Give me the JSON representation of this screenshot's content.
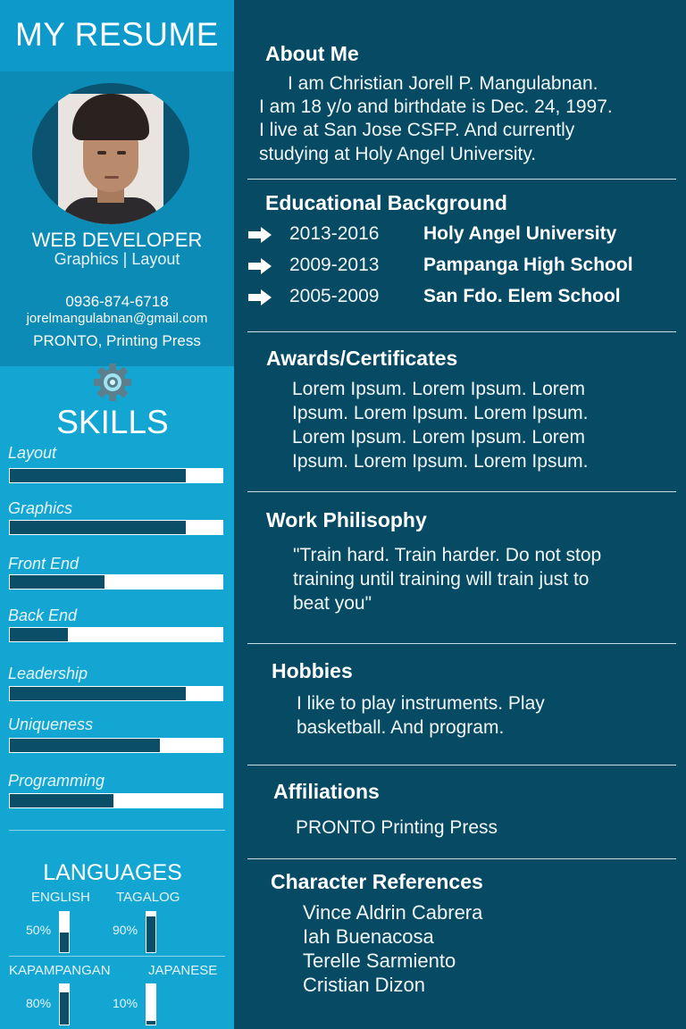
{
  "sidebar": {
    "title": "MY RESUME",
    "role": "WEB DEVELOPER",
    "role_sub": "Graphics | Layout",
    "phone": "0936-874-6718",
    "email": "jorelmangulabnan@gmail.com",
    "company": "PRONTO, Printing Press",
    "skills_title": "SKILLS",
    "skills": [
      {
        "label": "Layout",
        "level": 0.83
      },
      {
        "label": "Graphics",
        "level": 0.83
      },
      {
        "label": "Front End",
        "level": 0.45
      },
      {
        "label": "Back End",
        "level": 0.28
      },
      {
        "label": "Leadership",
        "level": 0.83
      },
      {
        "label": "Uniqueness",
        "level": 0.71
      },
      {
        "label": "Programming",
        "level": 0.49
      }
    ],
    "languages_title": "LANGUAGES",
    "languages": [
      {
        "name": "ENGLISH",
        "percent": "50%",
        "level": 0.5
      },
      {
        "name": "TAGALOG",
        "percent": "90%",
        "level": 0.9
      },
      {
        "name": "KAPAMPANGAN",
        "percent": "80%",
        "level": 0.8
      },
      {
        "name": "JAPANESE",
        "percent": "10%",
        "level": 0.1
      }
    ]
  },
  "about": {
    "title": "About Me",
    "lines": [
      "I am Christian Jorell P. Mangulabnan.",
      "I am 18 y/o and birthdate is Dec. 24, 1997.",
      "I live at San Jose CSFP. And currently",
      "studying at Holy Angel University."
    ]
  },
  "education": {
    "title": "Educational Background",
    "items": [
      {
        "years": "2013-2016",
        "school": "Holy Angel University"
      },
      {
        "years": "2009-2013",
        "school": "Pampanga High School"
      },
      {
        "years": "2005-2009",
        "school": "San Fdo. Elem School"
      }
    ]
  },
  "awards": {
    "title": "Awards/Certificates",
    "lines": [
      "Lorem Ipsum. Lorem Ipsum. Lorem",
      "Ipsum. Lorem Ipsum. Lorem Ipsum.",
      "Lorem Ipsum. Lorem Ipsum. Lorem",
      "Ipsum. Lorem Ipsum. Lorem Ipsum."
    ]
  },
  "philosophy": {
    "title": "Work Philisophy",
    "lines": [
      "\"Train hard. Train harder. Do not stop",
      "training until training will train just to",
      "beat you\""
    ]
  },
  "hobbies": {
    "title": "Hobbies",
    "lines": [
      "I like to play instruments. Play",
      "basketball. And program."
    ]
  },
  "affiliations": {
    "title": "Affiliations",
    "text": "PRONTO Printing Press"
  },
  "references": {
    "title": "Character References",
    "names": [
      "Vince Aldrin Cabrera",
      "Iah Buenacosa",
      "Terelle Sarmiento",
      "Cristian Dizon"
    ]
  },
  "colors": {
    "dark_panel": "#064a63",
    "sidebar": "#13a6d3",
    "bar_fill": "#0a4e67"
  },
  "icons": {
    "skills": "gear-icon",
    "education_bullet": "arrow-right-icon"
  }
}
